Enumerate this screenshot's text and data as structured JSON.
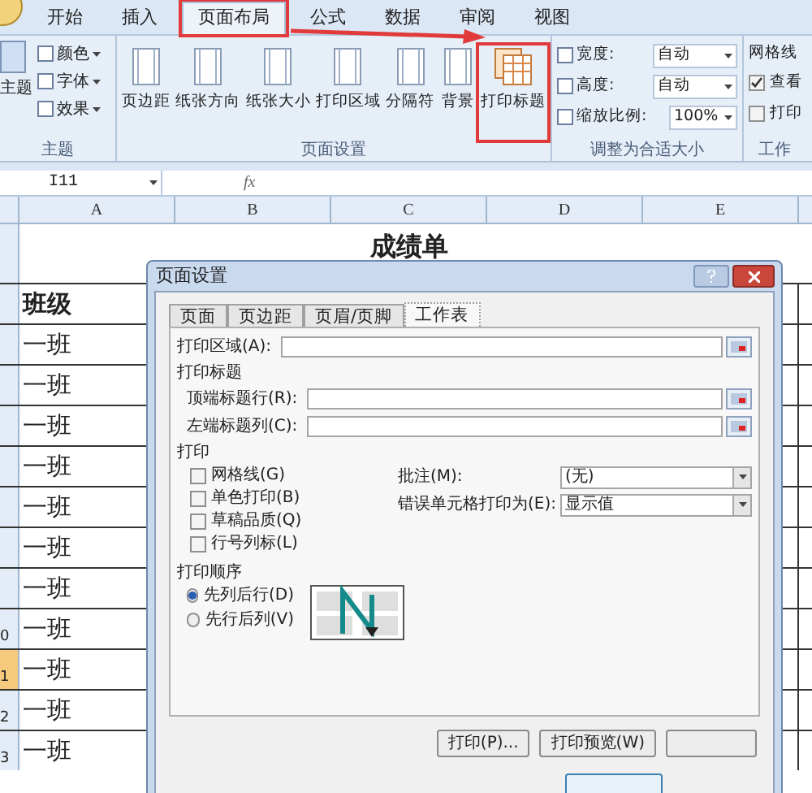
{
  "ribbon_tabs": [
    {
      "label": "开始",
      "selected": false,
      "highlighted": false
    },
    {
      "label": "插入",
      "selected": false,
      "highlighted": false
    },
    {
      "label": "页面布局",
      "selected": true,
      "highlighted": true
    },
    {
      "label": "公式",
      "selected": false,
      "highlighted": false
    },
    {
      "label": "数据",
      "selected": false,
      "highlighted": false
    },
    {
      "label": "审阅",
      "selected": false,
      "highlighted": false
    },
    {
      "label": "视图",
      "selected": false,
      "highlighted": false
    }
  ],
  "theme_group": {
    "title": "主题",
    "main": "主题",
    "items": [
      "颜色",
      "字体",
      "效果"
    ]
  },
  "page_setup_group": {
    "title": "页面设置",
    "buttons": [
      {
        "label": "页边距",
        "highlighted": false
      },
      {
        "label": "纸张方向",
        "highlighted": false
      },
      {
        "label": "纸张大小",
        "highlighted": false
      },
      {
        "label": "打印区域",
        "highlighted": false
      },
      {
        "label": "分隔符",
        "highlighted": false
      },
      {
        "label": "背景",
        "highlighted": false
      },
      {
        "label": "打印标题",
        "highlighted": true
      }
    ]
  },
  "scale_group": {
    "title": "调整为合适大小",
    "rows": [
      {
        "kind": "dropdown",
        "label": "宽度:",
        "value": "自动"
      },
      {
        "kind": "dropdown",
        "label": "高度:",
        "value": "自动"
      },
      {
        "kind": "spinner",
        "label": "缩放比例:",
        "value": "100%"
      }
    ]
  },
  "sheet_options_group": {
    "title": "工作",
    "header": "网格线",
    "options": [
      {
        "label": "查看",
        "checked": true
      },
      {
        "label": "打印",
        "checked": false
      }
    ]
  },
  "formula_bar": {
    "name_box": "I11",
    "fx": "fx"
  },
  "columns": [
    "A",
    "B",
    "C",
    "D",
    "E"
  ],
  "sheet": {
    "title": "成绩单",
    "header": "班级",
    "rows": [
      {
        "value": "一班",
        "selected": false
      },
      {
        "value": "一班",
        "selected": false
      },
      {
        "value": "一班",
        "selected": false
      },
      {
        "value": "一班",
        "selected": false
      },
      {
        "value": "一班",
        "selected": false
      },
      {
        "value": "一班",
        "selected": false
      },
      {
        "value": "一班",
        "selected": false
      },
      {
        "header": "0",
        "value": "一班",
        "selected": false
      },
      {
        "header": "1",
        "value": "一班",
        "selected": true
      },
      {
        "header": "2",
        "value": "一班",
        "selected": false
      },
      {
        "header": "3",
        "value": "一班",
        "selected": false
      }
    ]
  },
  "dialog": {
    "title": "页面设置",
    "tabs": [
      {
        "label": "页面",
        "selected": false
      },
      {
        "label": "页边距",
        "selected": false
      },
      {
        "label": "页眉/页脚",
        "selected": false
      },
      {
        "label": "工作表",
        "selected": true
      }
    ],
    "print_area_label": "打印区域(A):",
    "print_titles": {
      "heading": "打印标题",
      "fields": [
        {
          "label": "顶端标题行(R):"
        },
        {
          "label": "左端标题列(C):"
        }
      ]
    },
    "print": {
      "heading": "打印",
      "options": [
        {
          "label": "网格线(G)",
          "checked": false
        },
        {
          "label": "单色打印(B)",
          "checked": false
        },
        {
          "label": "草稿品质(Q)",
          "checked": false
        },
        {
          "label": "行号列标(L)",
          "checked": false
        }
      ],
      "selects": [
        {
          "label": "批注(M):",
          "value": "(无)"
        },
        {
          "label": "错误单元格打印为(E):",
          "value": "显示值"
        }
      ]
    },
    "order": {
      "heading": "打印顺序",
      "options": [
        {
          "label": "先列后行(D)",
          "selected": true
        },
        {
          "label": "先行后列(V)",
          "selected": false
        }
      ]
    },
    "buttons": [
      "打印(P)...",
      "打印预览(W)"
    ]
  }
}
